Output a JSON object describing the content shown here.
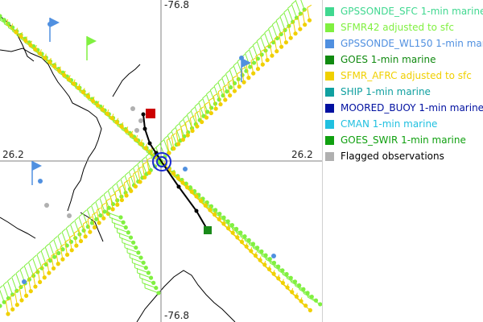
{
  "map": {
    "coord_labels": {
      "top_lon": "-76.8",
      "bottom_lon": "-76.8",
      "left_lat": "26.2",
      "right_lat": "26.2"
    },
    "colors": {
      "coastline": "#000000",
      "grid": "#808080",
      "track": "#000000",
      "center_ring": "#1a2bd0",
      "start_marker": "#cc0000",
      "end_marker": "#1a8a1a"
    }
  },
  "legend": {
    "items": [
      {
        "label": "GPSSONDE_SFC 1-min marine",
        "color": "#40d890",
        "text_color": "#40d890"
      },
      {
        "label": "SFMR42 adjusted to sfc",
        "color": "#80f040",
        "text_color": "#80f040"
      },
      {
        "label": "GPSSONDE_WL150 1-min marine",
        "color": "#5090e0",
        "text_color": "#5090e0"
      },
      {
        "label": "GOES 1-min marine",
        "color": "#108a10",
        "text_color": "#108a10"
      },
      {
        "label": "SFMR_AFRC adjusted to sfc",
        "color": "#f0d000",
        "text_color": "#f0d000"
      },
      {
        "label": "SHIP 1-min marine",
        "color": "#10a0a0",
        "text_color": "#10a0a0"
      },
      {
        "label": "MOORED_BUOY 1-min marine",
        "color": "#0010a0",
        "text_color": "#0010a0"
      },
      {
        "label": "CMAN 1-min marine",
        "color": "#20c0e0",
        "text_color": "#20c0e0"
      },
      {
        "label": "GOES_SWIR 1-min marine",
        "color": "#10a010",
        "text_color": "#10a010"
      },
      {
        "label": "Flagged observations",
        "color": "#b0b0b0",
        "text_color": "#000000"
      }
    ]
  }
}
